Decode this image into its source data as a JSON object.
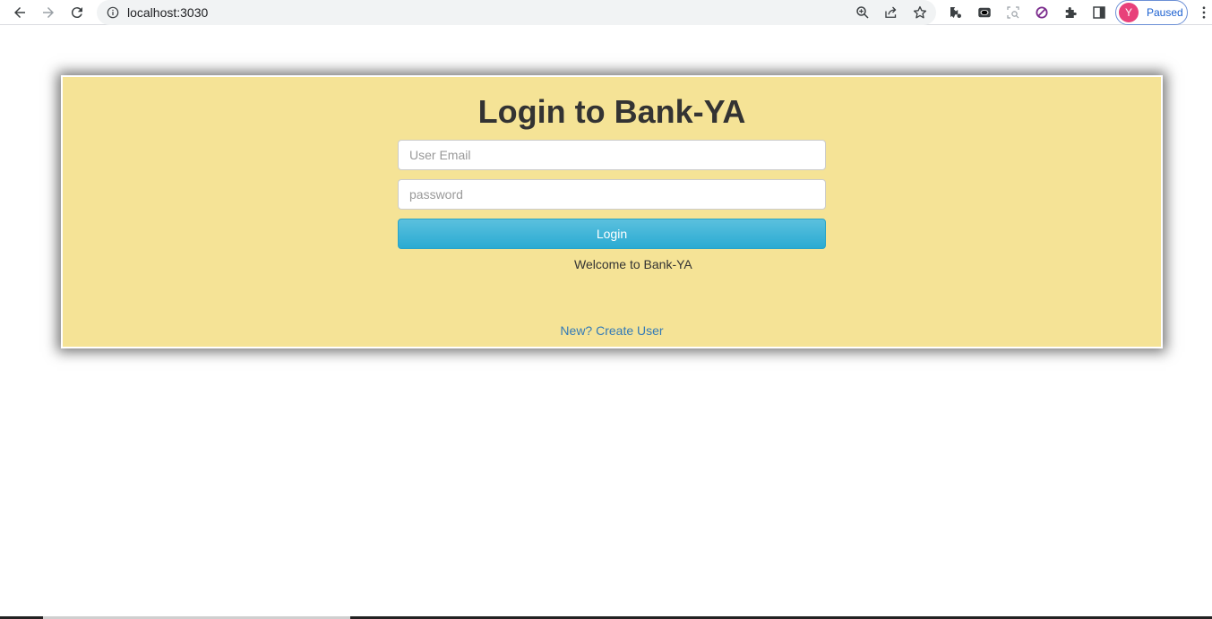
{
  "browser": {
    "url": "localhost:3030",
    "profile_initial": "Y",
    "profile_status": "Paused",
    "icons": [
      "back-icon",
      "forward-icon",
      "reload-icon",
      "info-icon",
      "zoom-icon",
      "share-icon",
      "star-icon",
      "extension-icon",
      "chat-extension-icon",
      "screenshot-extension-icon",
      "block-extension-icon",
      "puzzle-icon",
      "sidepanel-icon",
      "kebab-menu-icon"
    ]
  },
  "login": {
    "title": "Login to Bank-YA",
    "email_placeholder": "User Email",
    "email_value": "",
    "password_placeholder": "password",
    "password_value": "",
    "login_label": "Login",
    "welcome_text": "Welcome to Bank-YA",
    "create_link": "New? Create User"
  },
  "colors": {
    "panel_bg": "#f5e396",
    "button": "#31b0d5",
    "link": "#337ab7"
  }
}
